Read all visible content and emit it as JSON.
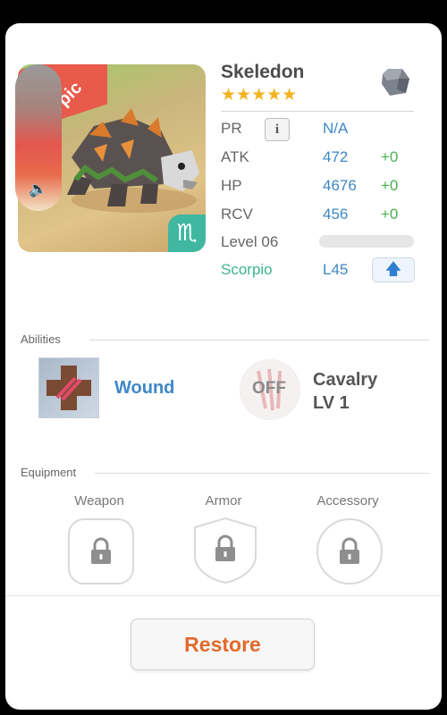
{
  "monster": {
    "name": "Skeledon",
    "stars": "★★★★★",
    "ribbon_text": "pic",
    "zodiac_symbol": "♏"
  },
  "stats": {
    "pr": {
      "label": "PR",
      "value": "N/A",
      "info_icon": "i"
    },
    "atk": {
      "label": "ATK",
      "value": "472",
      "bonus": "+0"
    },
    "hp": {
      "label": "HP",
      "value": "4676",
      "bonus": "+0"
    },
    "rcv": {
      "label": "RCV",
      "value": "456",
      "bonus": "+0"
    },
    "level": {
      "label": "Level 06",
      "progress": 0
    },
    "sign": {
      "label": "Scorpio",
      "level": "L45"
    }
  },
  "abilities": {
    "title": "Abilities",
    "active": {
      "name": "Wound"
    },
    "leader": {
      "state": "OFF",
      "name_line1": "Cavalry",
      "name_line2": "LV 1"
    }
  },
  "equipment": {
    "title": "Equipment",
    "slots": [
      {
        "label": "Weapon"
      },
      {
        "label": "Armor"
      },
      {
        "label": "Accessory"
      }
    ]
  },
  "footer": {
    "restore_label": "Restore"
  },
  "colors": {
    "accent_blue": "#3f87c7",
    "bonus_green": "#4caf50",
    "restore_orange": "#e2692c",
    "star_gold": "#f2b320"
  }
}
